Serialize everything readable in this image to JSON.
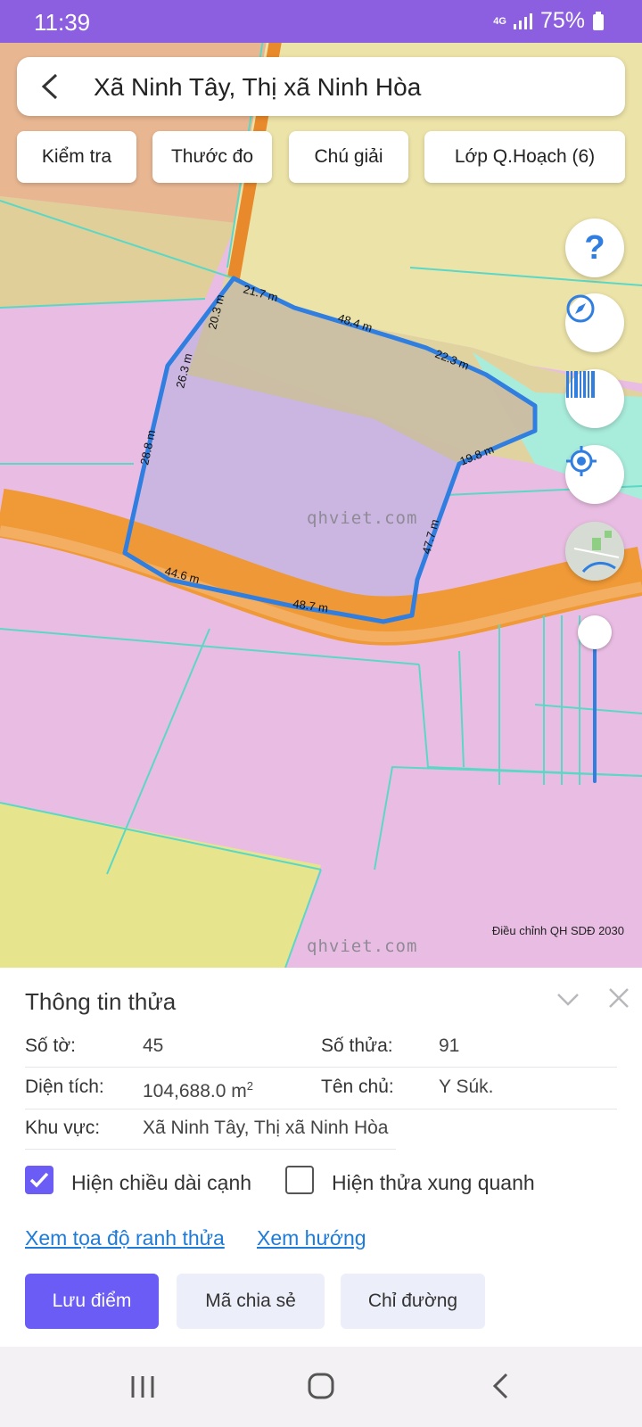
{
  "status_bar": {
    "time": "11:39",
    "network": "4G",
    "battery": "75%"
  },
  "search": {
    "title": "Xã Ninh Tây, Thị xã Ninh Hòa"
  },
  "toolbar": {
    "check_label": "Kiểm tra",
    "measure_label": "Thước đo",
    "legend_label": "Chú giải",
    "layers_label": "Lớp Q.Hoạch (6)"
  },
  "map_controls": {
    "help_glyph": "?",
    "icons": [
      "help-icon",
      "compass-icon",
      "barcode-icon",
      "my-location-icon",
      "map-thumbnail"
    ]
  },
  "map": {
    "watermark": "qhviet.com",
    "plan_label": "Điều chỉnh QH SDĐ 2030",
    "edge_lengths": [
      "21.7 m",
      "20.3 m",
      "48.4 m",
      "22.3 m",
      "26.3 m",
      "28.8 m",
      "19.8 m",
      "47.7 m",
      "44.6 m",
      "48.7 m"
    ],
    "boundary_color": "#2f7ee0"
  },
  "panel": {
    "title": "Thông tin thửa",
    "so_to_label": "Số tờ:",
    "so_to_value": "45",
    "so_thua_label": "Số thửa:",
    "so_thua_value": "91",
    "dien_tich_label": "Diện tích:",
    "dien_tich_value": "104,688.0 m",
    "dien_tich_unit_sup": "2",
    "ten_chu_label": "Tên chủ:",
    "ten_chu_value": "Y Súk.",
    "khu_vuc_label": "Khu vực:",
    "khu_vuc_value": "Xã Ninh Tây, Thị xã Ninh Hòa",
    "show_edge_lengths": {
      "label": "Hiện chiều dài cạnh",
      "checked": true
    },
    "show_neighbors": {
      "label": "Hiện thửa xung quanh",
      "checked": false
    },
    "link_coords": "Xem tọa độ ranh thửa",
    "link_direction": "Xem hướng",
    "btn_save": "Lưu điểm",
    "btn_share": "Mã chia sẻ",
    "btn_directions": "Chỉ đường"
  },
  "colors": {
    "accent": "#6b5cf6",
    "link": "#1f7bd8",
    "road": "#f0962e",
    "boundary": "#2f7ee0"
  }
}
